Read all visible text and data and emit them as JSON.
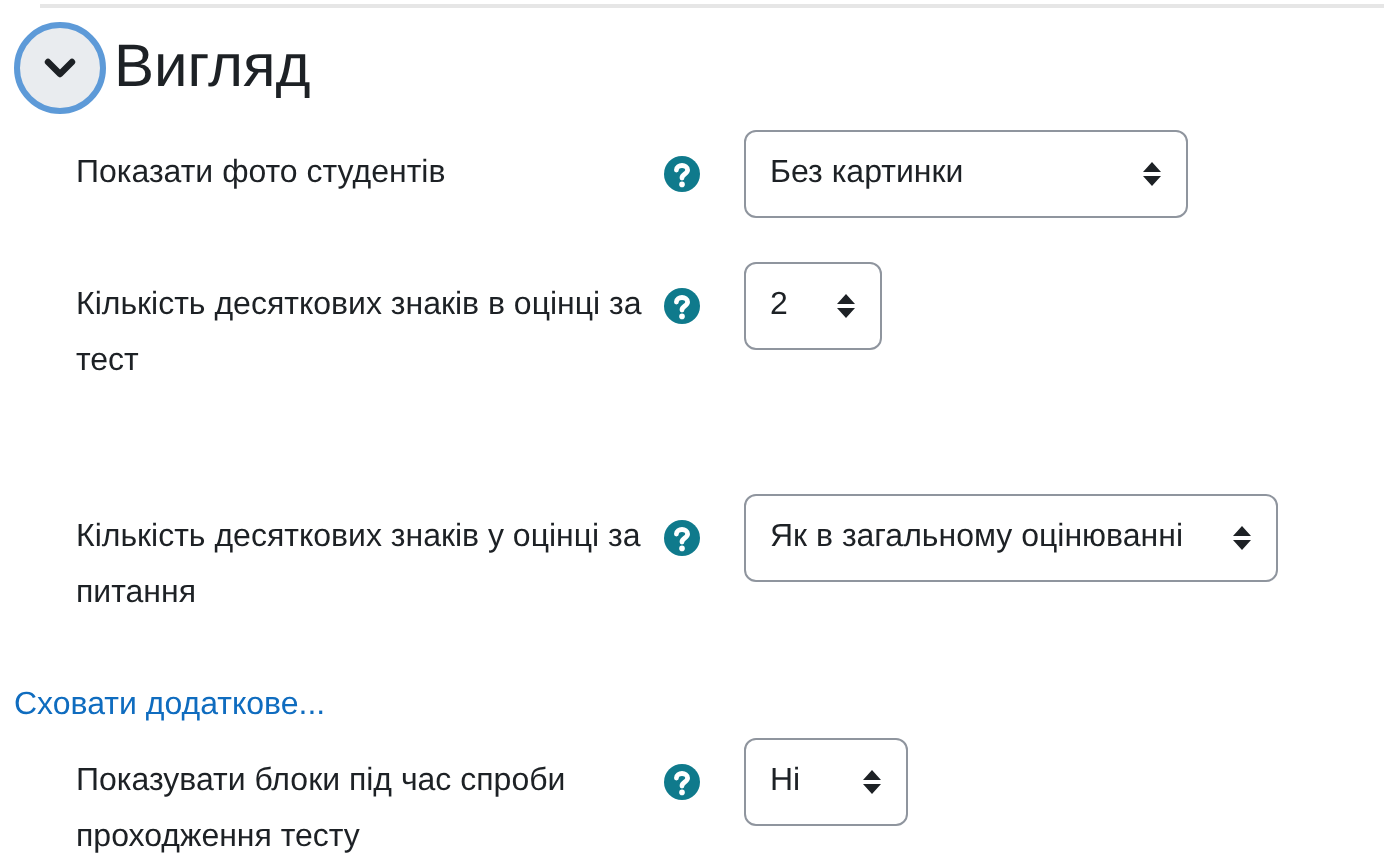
{
  "section": {
    "title": "Вигляд",
    "expanded": true
  },
  "settings": [
    {
      "label": "Показати фото студентів",
      "value": "Без картинки"
    },
    {
      "label": "Кількість десяткових знаків в оцінці за тест",
      "value": "2"
    },
    {
      "label": "Кількість десяткових знаків у оцінці за питання",
      "value": "Як в загальному оцінюванні"
    }
  ],
  "advanced_link": "Сховати додаткове...",
  "advanced_settings": [
    {
      "label": "Показувати блоки під час спроби проходження тесту",
      "value": "Ні"
    }
  ]
}
